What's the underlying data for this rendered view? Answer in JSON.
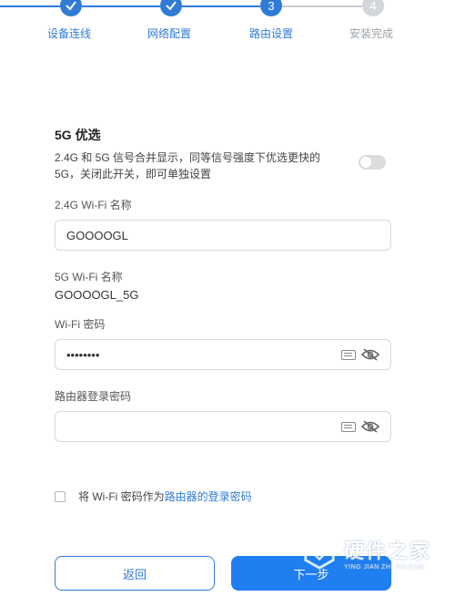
{
  "stepper": {
    "steps": [
      {
        "label": "设备连线",
        "state": "done"
      },
      {
        "label": "网络配置",
        "state": "done"
      },
      {
        "label": "路由设置",
        "state": "active",
        "number": "3"
      },
      {
        "label": "安装完成",
        "state": "todo",
        "number": "4"
      }
    ]
  },
  "band5g": {
    "title": "5G 优选",
    "description": "2.4G 和 5G 信号合并显示，同等信号强度下优选更快的 5G，关闭此开关，即可单独设置",
    "toggle_on": false
  },
  "wifi24": {
    "label": "2.4G Wi-Fi 名称",
    "value": "GOOOOGL"
  },
  "wifi5": {
    "label": "5G Wi-Fi 名称",
    "value": "GOOOOGL_5G"
  },
  "wifi_password": {
    "label": "Wi-Fi 密码",
    "value": "••••••••"
  },
  "router_password": {
    "label": "路由器登录密码",
    "value": ""
  },
  "checkbox": {
    "prefix": "将 Wi-Fi 密码作为",
    "link": "路由器的登录密码",
    "checked": false
  },
  "buttons": {
    "back": "返回",
    "next": "下一步"
  },
  "watermark": {
    "cn": "硬件之家",
    "en": "YING JIAN ZHI JIA.COM"
  },
  "colors": {
    "accent": "#2f7bd6",
    "primary_button": "#1f7ef0"
  }
}
